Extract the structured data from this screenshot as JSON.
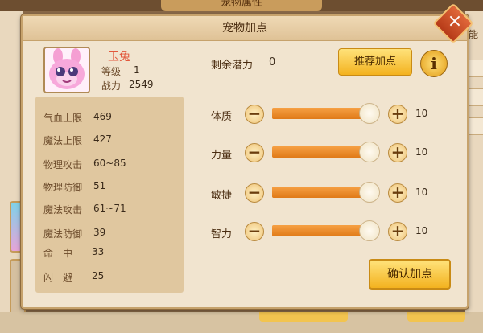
{
  "background": {
    "title": "宠物属性",
    "side_text": "能"
  },
  "dialog": {
    "title": "宠物加点",
    "close_glyph": "×"
  },
  "pet": {
    "name": "玉兔",
    "level_label": "等级",
    "level": "1",
    "power_label": "战力",
    "power": "2549"
  },
  "stats": [
    {
      "label": "气血上限",
      "value": "469"
    },
    {
      "label": "魔法上限",
      "value": "427"
    },
    {
      "label": "物理攻击",
      "value": "60~85"
    },
    {
      "label": "物理防御",
      "value": "51"
    },
    {
      "label": "魔法攻击",
      "value": "61~71"
    },
    {
      "label": "魔法防御",
      "value": "39"
    },
    {
      "label": "命　中",
      "value": "33"
    },
    {
      "label": "闪　避",
      "value": "25"
    }
  ],
  "potential": {
    "label": "剩余潜力",
    "value": "0"
  },
  "buttons": {
    "recommend": "推荐加点",
    "info": "i",
    "confirm": "确认加点",
    "minus": "−",
    "plus": "+"
  },
  "attributes": [
    {
      "name": "体质",
      "value": "10",
      "fill_fraction": 1.0
    },
    {
      "name": "力量",
      "value": "10",
      "fill_fraction": 1.0
    },
    {
      "name": "敏捷",
      "value": "10",
      "fill_fraction": 1.0
    },
    {
      "name": "智力",
      "value": "10",
      "fill_fraction": 1.0
    }
  ],
  "colors": {
    "accent": "#f3b21f",
    "slider_fill": "#e07a18",
    "name_color": "#e2583c"
  }
}
